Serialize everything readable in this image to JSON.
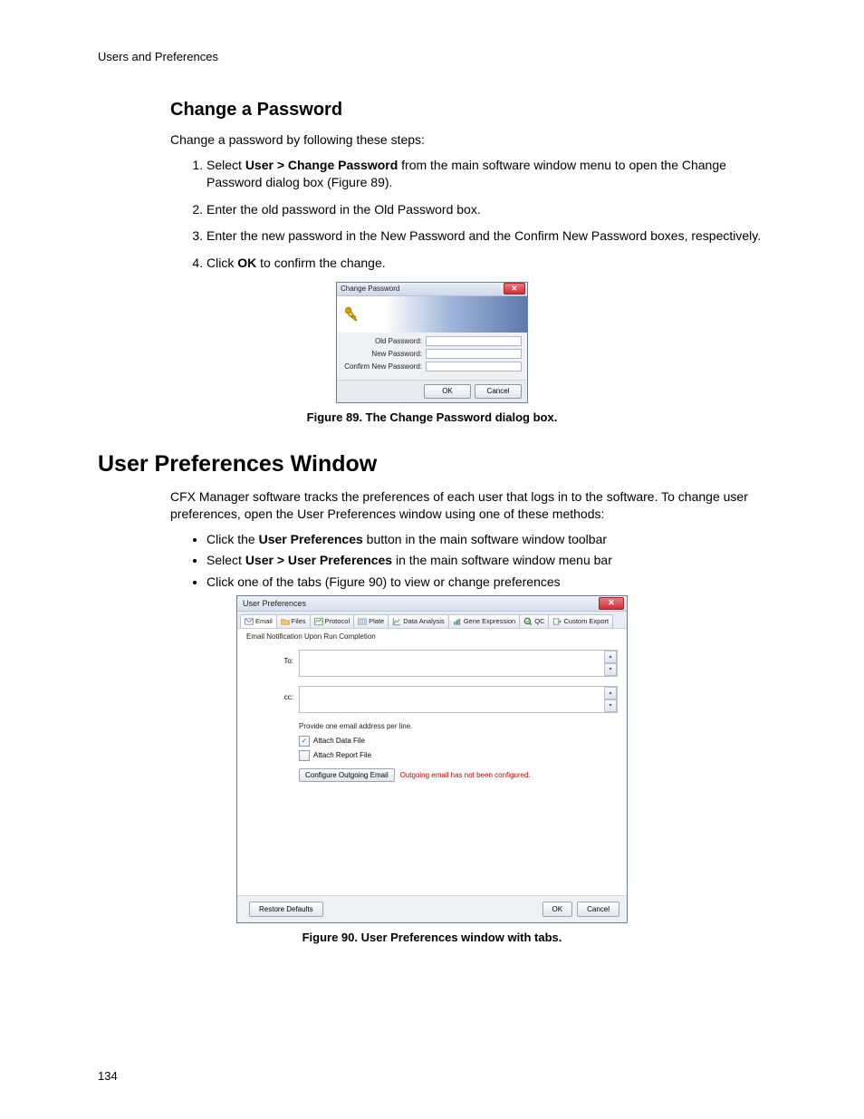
{
  "header": {
    "running": "Users and Preferences"
  },
  "page_number": "134",
  "section1": {
    "title": "Change a Password",
    "intro": "Change a password by following these steps:",
    "steps": {
      "s1_pre": "Select ",
      "s1_bold": "User > Change Password",
      "s1_post": " from the main software window menu to open the Change Password dialog box (Figure 89).",
      "s2": "Enter the old password in the Old Password box.",
      "s3": "Enter the new password in the New Password and the Confirm New Password boxes, respectively.",
      "s4_pre": "Click ",
      "s4_bold": "OK",
      "s4_post": " to confirm the change."
    },
    "caption": "Figure 89. The Change Password dialog box."
  },
  "cp_dialog": {
    "title": "Change Password",
    "labels": {
      "old": "Old Password:",
      "new": "New Password:",
      "confirm": "Confirm New Password:"
    },
    "buttons": {
      "ok": "OK",
      "cancel": "Cancel"
    }
  },
  "section2": {
    "title": "User Preferences Window",
    "intro": "CFX Manager software tracks the preferences of each user that logs in to the software. To change user preferences, open the User Preferences window using one of these methods:",
    "bullets": {
      "b1_pre": "Click the ",
      "b1_bold": "User Preferences",
      "b1_post": " button in the main software window toolbar",
      "b2_pre": "Select ",
      "b2_bold": "User > User Preferences",
      "b2_post": " in the main software window menu bar",
      "b3": "Click one of the tabs (Figure 90) to view or change preferences"
    },
    "caption": "Figure 90. User Preferences window with tabs."
  },
  "up_dialog": {
    "title": "User Preferences",
    "tabs": {
      "email": "Email",
      "files": "Files",
      "protocol": "Protocol",
      "plate": "Plate",
      "data_analysis": "Data Analysis",
      "gene_expression": "Gene Expression",
      "qc": "QC",
      "custom_export": "Custom Export"
    },
    "email": {
      "section_label": "Email Notification Upon Run Completion",
      "to_label": "To:",
      "cc_label": "cc:",
      "hint": "Provide one email address per line.",
      "attach_data": "Attach Data File",
      "attach_report": "Attach Report File",
      "config_btn": "Configure Outgoing Email",
      "warning": "Outgoing email has not been configured."
    },
    "buttons": {
      "restore": "Restore Defaults",
      "ok": "OK",
      "cancel": "Cancel"
    }
  }
}
